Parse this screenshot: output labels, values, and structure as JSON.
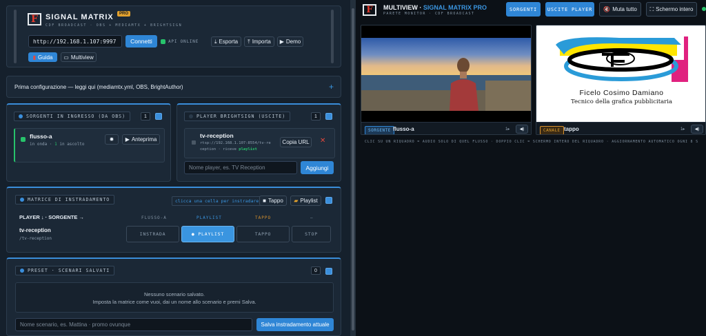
{
  "app": {
    "brand": "SIGNAL MATRIX",
    "badge": "PRO",
    "tagline": "CDF BROADCAST · OBS + MEDIAMTX + BRIGHTSIGN",
    "logo_letter": "F"
  },
  "connection": {
    "url": "http://192.168.1.107:9997",
    "connect_label": "Connetti",
    "status": "API ONLINE",
    "export_label": "Esporta",
    "import_label": "Importa",
    "demo_label": "Demo",
    "guide_label": "Guida",
    "multiview_label": "Multiview"
  },
  "setup": {
    "label": "Prima configurazione — leggi qui (mediamtx.yml, OBS, BrightAuthor)",
    "plus": "+"
  },
  "sources": {
    "title": "SORGENTI IN INGRESSO (DA OBS)",
    "count": "1",
    "item": {
      "name": "flusso-a",
      "meta_prefix": "in onda · ",
      "meta_count": "1",
      "meta_suffix": " in ascolto",
      "preview_label": "Anteprima"
    }
  },
  "players": {
    "title": "PLAYER BRIGHTSIGN (USCITE)",
    "count": "1",
    "item": {
      "name": "tv-reception",
      "url_line1": "rtsp://192.168.1.107:8554/tv-re",
      "url_line2": "ception · riceve",
      "receives": "playlist",
      "copy_label": "Copia URL",
      "remove": "✕"
    },
    "input_placeholder": "Nome player, es. TV Reception",
    "add_label": "Aggiungi"
  },
  "matrix": {
    "title": "MATRICE DI INSTRADAMENTO",
    "hint": "clicca una cella per instradare",
    "tappo_label": "Tappo",
    "playlist_label": "Playlist",
    "corner": "PLAYER ↓ · SORGENTE →",
    "columns": [
      "FLUSSO-A",
      "PLAYLIST",
      "TAPPO",
      "—"
    ],
    "row_name": "tv-reception",
    "row_path": "/tv-reception",
    "cells": [
      "INSTRADA",
      "● PLAYLIST",
      "TAPPO",
      "STOP"
    ]
  },
  "presets": {
    "title": "PRESET · SCENARI SALVATI",
    "count": "0",
    "empty_line1": "Nessuno scenario salvato.",
    "empty_line2": "Imposta la matrice come vuoi, dai un nome allo scenario e premi Salva.",
    "input_placeholder": "Nome scenario, es. Mattina · promo ovunque",
    "save_label": "Salva instradamento attuale"
  },
  "multiview": {
    "title_a": "MULTIVIEW · ",
    "title_b": "SIGNAL MATRIX PRO",
    "subtitle": "PARETE MONITOR · CDF BROADCAST",
    "sources_btn": "SORGENTI",
    "outputs_btn": "USCITE PLAYER",
    "mute_all": "Muta tutto",
    "fullscreen": "Schermo intero",
    "tiles": [
      {
        "tag": "SORGENTE",
        "name": "flusso-a",
        "ratio": "1▸",
        "tag_color": "#2f86d6"
      },
      {
        "tag": "CANALE",
        "name": "tappo",
        "ratio": "1▸",
        "tag_color": "#d9922e"
      }
    ],
    "card_name": "Ficelo Cosimo Damiano",
    "card_role": "Tecnico della grafica pubblicitaria",
    "hint": "CLIC SU UN RIQUADRO = AUDIO SOLO DI QUEL FLUSSO · DOPPIO CLIC = SCHERMO INTERO DEL RIQUADRO · AGGIORNAMENTO AUTOMATICO OGNI 8 S"
  },
  "colors": {
    "accent": "#2f86d6",
    "online": "#27c36b",
    "danger": "#e5483c",
    "tappo": "#d9922e"
  }
}
